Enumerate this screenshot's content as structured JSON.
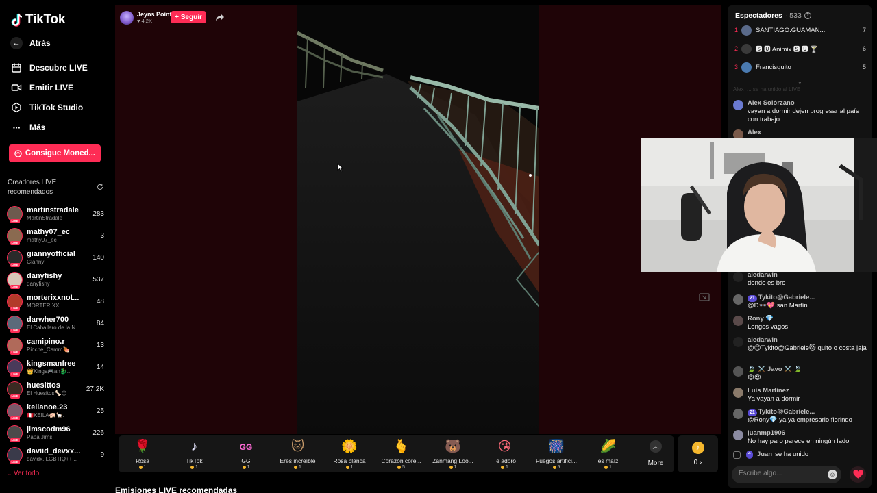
{
  "brand": {
    "name": "TikTok"
  },
  "sidebar": {
    "back_label": "Atrás",
    "nav": [
      {
        "label": "Descubre LIVE",
        "icon": "calendar-icon"
      },
      {
        "label": "Emitir LIVE",
        "icon": "camera-icon"
      },
      {
        "label": "TikTok Studio",
        "icon": "play-icon"
      },
      {
        "label": "Más",
        "icon": "more-icon"
      }
    ],
    "coins_label": "Consigue Moned...",
    "creators_title": "Creadores LIVE recomendados",
    "creators": [
      {
        "name": "martinstradale",
        "sub": "MartinStradale",
        "count": "283"
      },
      {
        "name": "mathy07_ec",
        "sub": "mathy07_ec",
        "count": "3"
      },
      {
        "name": "giannyofficial",
        "sub": "Glanny",
        "count": "140"
      },
      {
        "name": "danyfishy",
        "sub": "danyfishy",
        "count": "537"
      },
      {
        "name": "morterixxnot...",
        "sub": "MORTERIXX",
        "count": "48"
      },
      {
        "name": "darwher700",
        "sub": "El Caballero de la N...",
        "count": "84"
      },
      {
        "name": "camipino.r",
        "sub": "Pinche_Camm🍖",
        "count": "13"
      },
      {
        "name": "kingsmanfree",
        "sub": "👑Kings🎮an🐉...",
        "count": "14"
      },
      {
        "name": "huesittos",
        "sub": "El Huesitos🦴😊",
        "count": "27.2K"
      },
      {
        "name": "keilanoe.23",
        "sub": "🇵🇪KEILA🐖🦙.",
        "count": "25"
      },
      {
        "name": "jimscodm96",
        "sub": "Papa Jims",
        "count": "226"
      },
      {
        "name": "daviid_devxx...",
        "sub": "davidx. LGBTIQ++...",
        "count": "9"
      }
    ],
    "see_all": "Ver todo"
  },
  "stream": {
    "host_name": "Jeyns Point",
    "host_likes": "4.2K",
    "follow_label": "+ Seguir"
  },
  "gifts": [
    {
      "name": "Rosa",
      "price": "1",
      "icon": "🌹"
    },
    {
      "name": "TikTok",
      "price": "1",
      "icon": "♪"
    },
    {
      "name": "GG",
      "price": "1",
      "icon": "GG"
    },
    {
      "name": "Eres increíble",
      "price": "1",
      "icon": "🐱"
    },
    {
      "name": "Rosa blanca",
      "price": "1",
      "icon": "🌼"
    },
    {
      "name": "Corazón core...",
      "price": "5",
      "icon": "🫰"
    },
    {
      "name": "Zanmang Loo...",
      "price": "1",
      "icon": "🐻"
    },
    {
      "name": "Te adoro",
      "price": "1",
      "icon": "😘"
    },
    {
      "name": "Fuegos artifici...",
      "price": "5",
      "icon": "🎆"
    },
    {
      "name": "es maíz",
      "price": "1",
      "icon": "🌽"
    }
  ],
  "gifts_more": "More",
  "balance": "0 ›",
  "recommended_title": "Emisiones LIVE recomendadas",
  "viewers": {
    "title": "Espectadores",
    "count": "533",
    "top": [
      {
        "rank": "1",
        "name": "SANTIAGO.GUAMAN...",
        "score": "7"
      },
      {
        "rank": "2",
        "name": "🆂 🆄 Animix 🆂 🆄 🍸",
        "score": "6"
      },
      {
        "rank": "3",
        "name": "Francisquito",
        "score": "5"
      }
    ]
  },
  "chat": {
    "faded_line": "Alex_... se ha unido al LIVE",
    "messages": [
      {
        "user": "Alex Solórzano",
        "text": "vayan a dormir dejen progresar al país con trabajo"
      },
      {
        "user": "Alex",
        "text": ""
      },
      {
        "user": "aledarwin",
        "text": "donde es bro"
      },
      {
        "user": "Tykito@Gabriele...",
        "badge": "21",
        "text": "@D👓💖 san Martín"
      },
      {
        "user": "Rony 💎",
        "text": "Longos vagos"
      },
      {
        "user": "aledarwin",
        "text": "@😊Tykito@Gabriele🐱 quito o costa jaja"
      },
      {
        "user": "🍃 ⚔️ Javo ⚔️ 🍃",
        "text": "😍😍"
      },
      {
        "user": "Luis Martinez",
        "text": "Ya vayan a dormir"
      },
      {
        "user": "Tykito@Gabriele...",
        "badge": "21",
        "text": "@Rony💎 ya ya empresario florindo"
      },
      {
        "user": "juanmp1906",
        "text": "No hay paro parece en ningún lado"
      },
      {
        "user": "Juan",
        "badge": "4",
        "text": "se ha unido"
      }
    ],
    "input_placeholder": "Escribe algo..."
  },
  "colors": {
    "accent": "#fe2c55",
    "panel": "#121212",
    "stage": "#1f0407"
  }
}
